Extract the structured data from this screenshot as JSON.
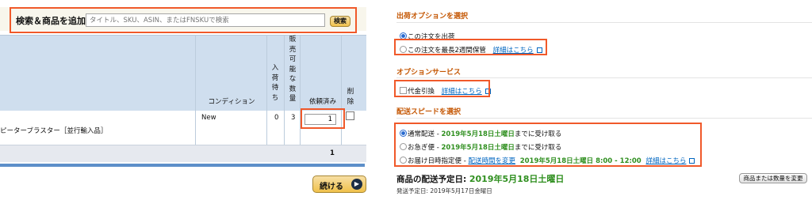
{
  "search": {
    "label": "検索＆商品を追加:",
    "placeholder": "タイトル、SKU、ASIN、またはFNSKUで検索",
    "button": "検索"
  },
  "table": {
    "headers": {
      "condition": "コンディション",
      "inbound": [
        "入",
        "荷",
        "待",
        "ち"
      ],
      "available": [
        "販",
        "売",
        "可",
        "能",
        "な",
        "数",
        "量"
      ],
      "requested": "依頼済み",
      "delete": [
        "削",
        "除"
      ]
    },
    "rows": [
      {
        "product": "ピーターブラスター［並行輸入品］",
        "condition": "New",
        "inbound": "0",
        "available": "3",
        "requested": "1"
      }
    ],
    "total": "1"
  },
  "continue_button": "続ける",
  "shipping_options": {
    "title": "出荷オプションを選択",
    "options": [
      {
        "label": "この注文を出荷",
        "selected": true
      },
      {
        "label": "この注文を最長2週間保管",
        "link": "詳細はこちら",
        "selected": false
      }
    ]
  },
  "option_services": {
    "title": "オプションサービス",
    "cod_label": "代金引換",
    "cod_link": "詳細はこちら"
  },
  "delivery_speed": {
    "title": "配送スピードを選択",
    "options": [
      {
        "name": "通常配送",
        "sep": " - ",
        "date": "2019年5月18日土曜日",
        "suffix": "までに受け取る",
        "selected": true
      },
      {
        "name": "お急ぎ便",
        "sep": " - ",
        "date": "2019年5月18日土曜日",
        "suffix": "までに受け取る",
        "selected": false
      },
      {
        "name": "お届け日時指定便",
        "sep": " - ",
        "link": "配送時間を変更",
        "date": "2019年5月18日土曜日 8:00 - 12:00",
        "link2": "詳細はこちら",
        "selected": false
      }
    ]
  },
  "delivery_estimate": {
    "label": "商品の配送予定日: ",
    "date": "2019年5月18日土曜日",
    "ship_date": "発送予定日: 2019年5月17日金曜日",
    "change_button": "商品または数量を変更"
  },
  "colors": {
    "highlight": "#f0592a",
    "section_title": "#c45500",
    "date_green": "#2f8f1f",
    "link": "#0066c0",
    "table_header": "#cfdeee"
  }
}
